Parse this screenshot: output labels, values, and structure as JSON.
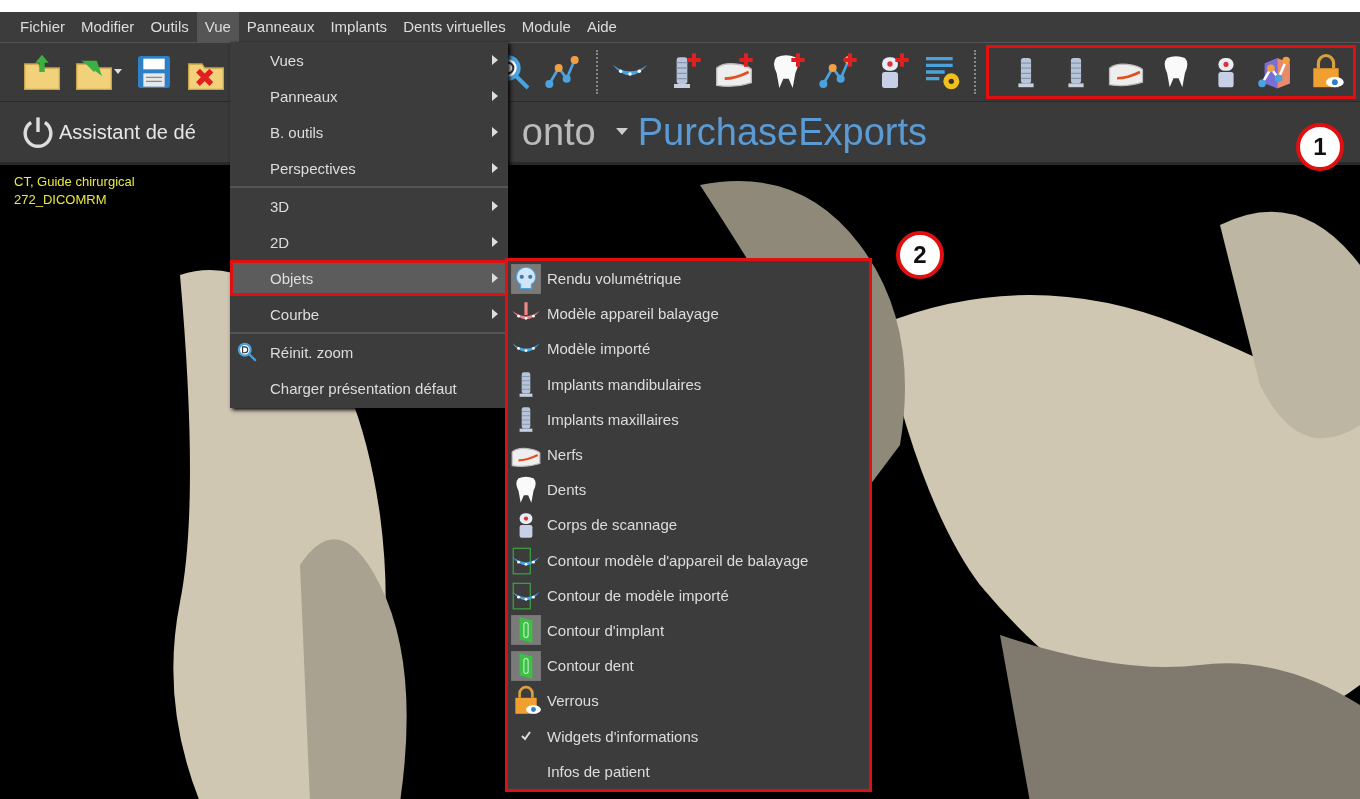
{
  "menubar": [
    {
      "label": "Fichier",
      "selected": false
    },
    {
      "label": "Modifier",
      "selected": false
    },
    {
      "label": "Outils",
      "selected": false
    },
    {
      "label": "Vue",
      "selected": true
    },
    {
      "label": "Panneaux",
      "selected": false
    },
    {
      "label": "Implants",
      "selected": false
    },
    {
      "label": "Dents virtuelles",
      "selected": false
    },
    {
      "label": "Module",
      "selected": false
    },
    {
      "label": "Aide",
      "selected": false
    }
  ],
  "assistant_button": {
    "label": "Assistant de dé"
  },
  "module_selector": {
    "label": "onto"
  },
  "logo": "PurchaseExports",
  "viewport": {
    "info_lines": [
      "CT, Guide chirurgical",
      "272_DICOMRM"
    ]
  },
  "vue_menu": {
    "sections": [
      [
        {
          "label": "Vues",
          "submenu": true,
          "selected": false
        },
        {
          "label": "Panneaux",
          "submenu": true,
          "selected": false
        },
        {
          "label": "B. outils",
          "submenu": true,
          "selected": false
        },
        {
          "label": "Perspectives",
          "submenu": true,
          "selected": false
        }
      ],
      [
        {
          "label": "3D",
          "submenu": true,
          "selected": false
        },
        {
          "label": "2D",
          "submenu": true,
          "selected": false
        },
        {
          "label": "Objets",
          "submenu": true,
          "selected": true
        },
        {
          "label": "Courbe",
          "submenu": true,
          "selected": false
        }
      ],
      [
        {
          "label": "Réinit. zoom",
          "submenu": false,
          "selected": false
        },
        {
          "label": "Charger présentation défaut",
          "submenu": false,
          "selected": false
        }
      ]
    ]
  },
  "objets_submenu": [
    {
      "label": "Rendu volumétrique",
      "checked": false
    },
    {
      "label": "Modèle appareil balayage",
      "checked": false
    },
    {
      "label": "Modèle importé",
      "checked": false
    },
    {
      "label": "Implants mandibulaires",
      "checked": false
    },
    {
      "label": "Implants maxillaires",
      "checked": false
    },
    {
      "label": "Nerfs",
      "checked": false
    },
    {
      "label": "Dents",
      "checked": false
    },
    {
      "label": "Corps de scannage",
      "checked": false
    },
    {
      "label": "Contour modèle d'appareil de balayage",
      "checked": false
    },
    {
      "label": "Contour de modèle importé",
      "checked": false
    },
    {
      "label": "Contour d'implant",
      "checked": false
    },
    {
      "label": "Contour dent",
      "checked": false
    },
    {
      "label": "Verrous",
      "checked": false
    },
    {
      "label": "Widgets d'informations",
      "checked": true
    },
    {
      "label": "Infos de patient",
      "checked": false
    }
  ],
  "callouts": [
    {
      "label": "1"
    },
    {
      "label": "2"
    }
  ]
}
